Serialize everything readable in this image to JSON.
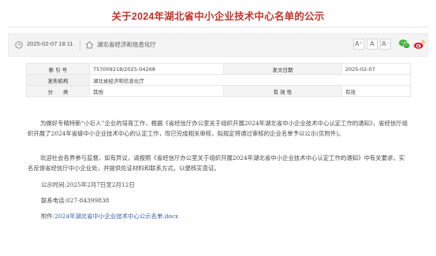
{
  "title": "关于2024年湖北省中小企业技术中心名单的公示",
  "infobar": {
    "date": "2025-02-07 18:11",
    "source": "湖北省经济和信息化厅",
    "font_buttons": [
      "A⁺",
      "A",
      "A⁻"
    ],
    "icons": [
      "clock-icon",
      "home-icon",
      "wechat-icon",
      "weibo-icon"
    ]
  },
  "meta": {
    "index_label": "索 引 号",
    "index_value": "757009218/2025-04268",
    "pubdate_label": "发文日期",
    "pubdate_value": "2025-02-07",
    "issuer_label": "发布机构",
    "issuer_value": "湖北省经济和信息化厅",
    "category_label": "分　　类",
    "category_value": "其他",
    "validity_label": "有 效 性",
    "validity_value": "有效"
  },
  "body": {
    "p1": "为做好专精特新“小巨人”企业的培育工作，根据《省经信厅办公室关于组织开展2024年湖北省中小企业技术中心认定工作的通知》，省经信厅组织开展了2024年省级中小企业技术中心的认定工作，现已完成相关审核，拟规定将通过审核的企业名单予以公示(见附件)。",
    "p2": "欢迎社会各界参与监督，如有异议，请按照《省经信厅办公室关于组织开展2024年湖北省中小企业技术中心认定工作的通知》中有关要求，实名反馈省经信厅中小企业处，并提供佐证材料和联系方式，以便核实查证。",
    "period": "公示时间:2025年2月7日至2月12日",
    "phone": "联系电话:027-84399838",
    "attachment_label": "附件:",
    "attachment_link": "2024年湖北省中小企业技术中心公示名单.docx"
  },
  "colors": {
    "title": "#c4332b",
    "link": "#3a5ea8",
    "wechat": "#3cb034",
    "weibo": "#e6162d"
  }
}
